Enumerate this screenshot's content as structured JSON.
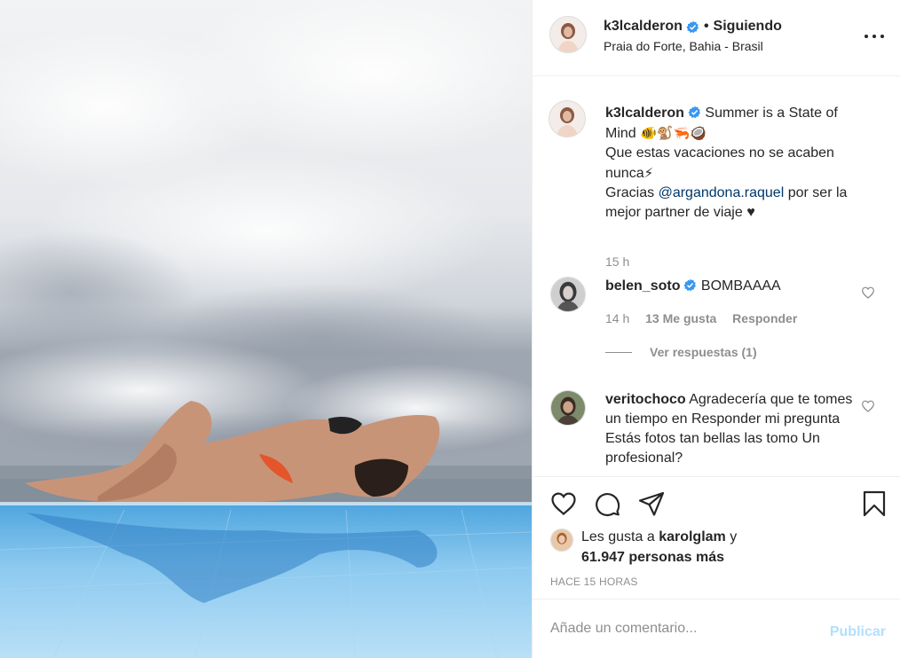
{
  "header": {
    "username": "k3lcalderon",
    "separator": "•",
    "follow_label": "Siguiendo",
    "location": "Praia do Forte, Bahia - Brasil",
    "more_icon": "more-options-icon"
  },
  "caption": {
    "username": "k3lcalderon",
    "line1": "Summer is a State of Mind",
    "emojis": "🐠🐒🦐🥥",
    "line2": "Que estas vacaciones no se acaben nunca",
    "emoji2": "⚡",
    "thanks_pre": "Gracias",
    "mention": "@argandona.raquel",
    "thanks_post": "por ser la mejor partner de viaje",
    "heart": "♥",
    "time": "15 h"
  },
  "comments": [
    {
      "username": "belen_soto",
      "text": "BOMBAAAA",
      "time": "14 h",
      "likes": "13 Me gusta",
      "reply_label": "Responder",
      "view_replies": "Ver respuestas (1)"
    },
    {
      "username": "veritochoco",
      "text": "Agradecería que te tomes un tiempo en Responder mi pregunta Estás fotos tan bellas las tomo Un profesional?"
    }
  ],
  "actions": {
    "icons": [
      "heart-icon",
      "comment-icon",
      "share-icon",
      "bookmark-icon"
    ]
  },
  "likes": {
    "prefix": "Les gusta a",
    "user": "karolglam",
    "conj": "y",
    "count_text": "61.947 personas más"
  },
  "posted": "HACE 15 HORAS",
  "add_comment": {
    "placeholder": "Añade un comentario...",
    "publish_label": "Publicar"
  },
  "colors": {
    "verified": "#3897f0",
    "link": "#00376b",
    "muted": "#8e8e8e",
    "publish_disabled": "#b2dffc"
  }
}
